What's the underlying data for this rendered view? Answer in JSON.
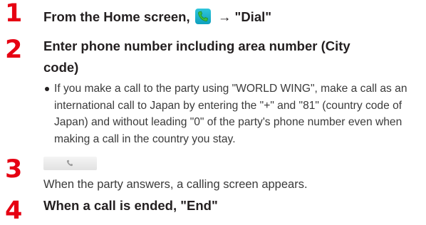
{
  "steps": [
    {
      "number": "1",
      "title_prefix": "From the Home screen,",
      "title_suffix": "→ \"Dial\""
    },
    {
      "number": "2",
      "title_line1": "Enter phone number including area number (City",
      "title_line2": "code)",
      "bullet": "If you make a call to the party using \"WORLD WING\", make a call as an international call to Japan by entering the \"+\" and \"81\" (country code of Japan) and without leading \"0\" of the party's phone number even when making a call in the country you stay."
    },
    {
      "number": "3",
      "description": "When the party answers, a calling screen appears."
    },
    {
      "number": "4",
      "title": "When a call is ended, \"End\""
    }
  ],
  "icons": {
    "phone_app": "phone-icon",
    "call_button": "call-button-icon"
  },
  "colors": {
    "step_number": "#e60012",
    "phone_icon": "#1fb4d2",
    "phone_handset": "#27a844"
  }
}
